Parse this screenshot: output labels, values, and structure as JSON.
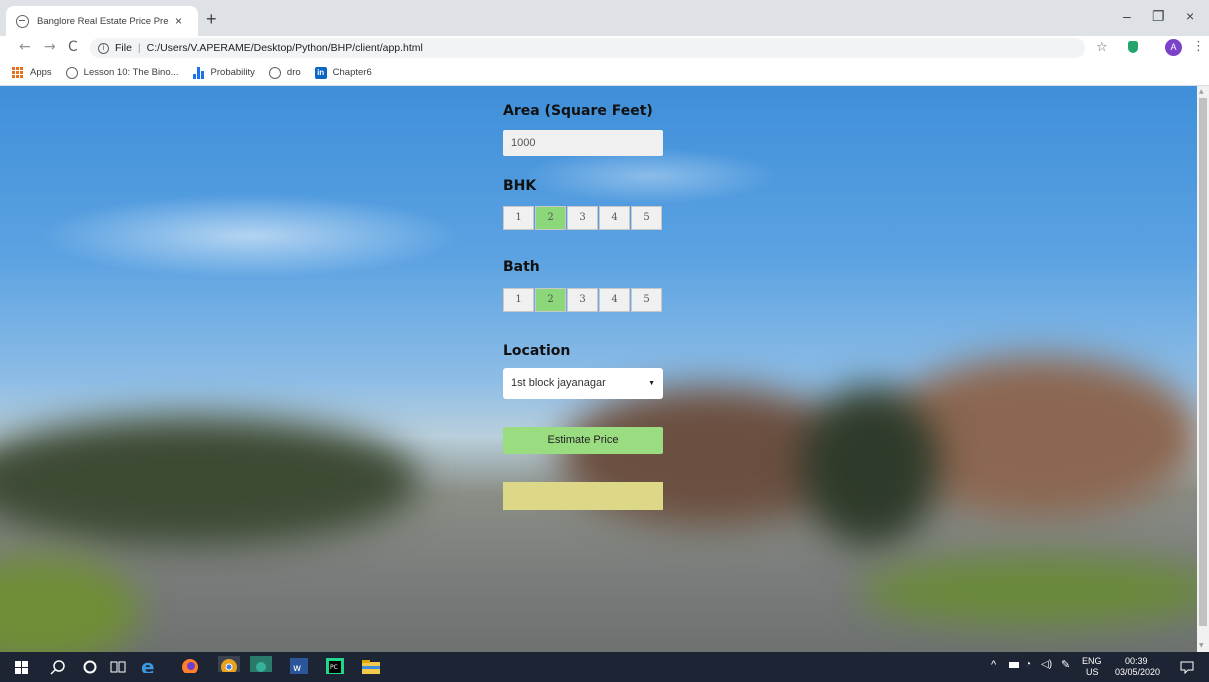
{
  "browser": {
    "tab_title": "Banglore Real Estate Price Predic",
    "tab_close": "×",
    "new_tab": "+",
    "window_controls": {
      "minimize": "–",
      "maximize": "❐",
      "close": "×"
    },
    "nav": {
      "back": "←",
      "forward": "→",
      "reload": "C"
    },
    "url_prefix": "File",
    "url": "C:/Users/V.APERAME/Desktop/Python/BHP/client/app.html",
    "profile_initial": "A",
    "bookmarks": [
      {
        "label": "Apps",
        "icon": "apps-grid-icon"
      },
      {
        "label": "Lesson 10: The Bino...",
        "icon": "globe-icon"
      },
      {
        "label": "Probability",
        "icon": "bar-chart-icon"
      },
      {
        "label": "dro",
        "icon": "globe-icon"
      },
      {
        "label": "Chapter6",
        "icon": "linkedin-icon"
      }
    ]
  },
  "form": {
    "area_label": "Area (Square Feet)",
    "area_value": "1000",
    "bhk_label": "BHK",
    "bhk_options": [
      "1",
      "2",
      "3",
      "4",
      "5"
    ],
    "bhk_selected": "2",
    "bath_label": "Bath",
    "bath_options": [
      "1",
      "2",
      "3",
      "4",
      "5"
    ],
    "bath_selected": "2",
    "location_label": "Location",
    "location_selected": "1st block jayanagar",
    "estimate_button": "Estimate Price",
    "result_text": ""
  },
  "colors": {
    "selected_option": "#8bd77a",
    "estimate_button": "#99dd80",
    "result_box": "#ddd888"
  },
  "taskbar": {
    "language": "ENG",
    "region": "US",
    "time": "00:39",
    "date": "03/05/2020"
  }
}
